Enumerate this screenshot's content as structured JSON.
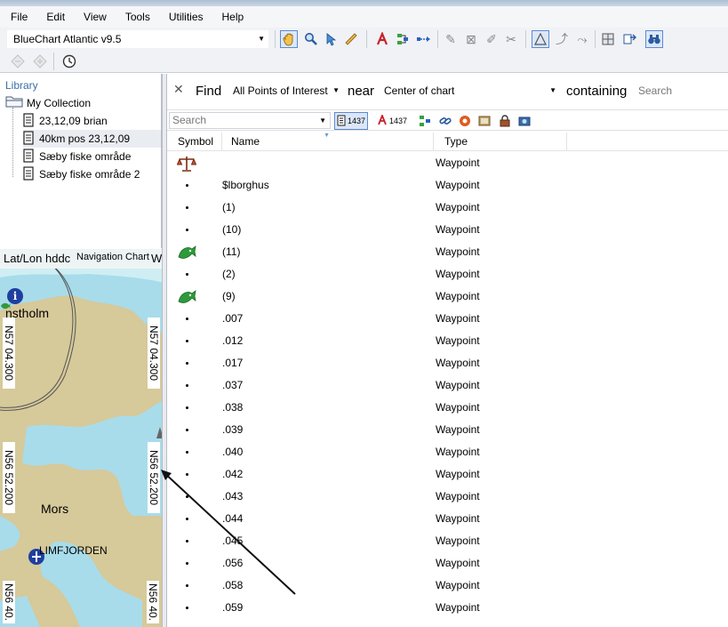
{
  "menu": [
    "File",
    "Edit",
    "View",
    "Tools",
    "Utilities",
    "Help"
  ],
  "toolbar": {
    "chart_select": "BlueChart Atlantic v9.5",
    "icons": [
      "hand-pan-icon",
      "zoom-icon",
      "pointer-icon",
      "measure-ruler-icon",
      "route-tool-icon",
      "track-tool-icon",
      "route-join-icon",
      "pencil-icon",
      "eraser-icon",
      "erase-all-icon",
      "cut-icon",
      "select-icon",
      "waypoint-tool-icon",
      "route-edit-icon",
      "grid-icon",
      "transfer-icon",
      "binoculars-icon"
    ]
  },
  "library": {
    "title": "Library",
    "collection": "My Collection",
    "items": [
      {
        "label": "23,12,09 brian"
      },
      {
        "label": "40km pos 23,12,09"
      },
      {
        "label": "Sæby fiske område"
      },
      {
        "label": "Sæby fiske område 2"
      }
    ]
  },
  "map": {
    "header_left": "Lat/Lon hddc",
    "header_tab": "Navigation Chart",
    "header_right": "W",
    "labels": {
      "place1": "nstholm",
      "place2": "Mors",
      "place3": "LIMFJORDEN",
      "lat1": "N57 04.300",
      "lat1r": "N57 04.300",
      "lat2": "N56 52.200",
      "lat2r": "N56 52.200",
      "lat3": "N56 40.",
      "lat3r": "N56 40."
    }
  },
  "find": {
    "find_label": "Find",
    "what": "All Points of Interest",
    "near_label": "near",
    "near": "Center of chart",
    "containing_label": "containing",
    "search_placeholder": "Search"
  },
  "filter": {
    "search_placeholder": "Search",
    "waypoint_count": "1437",
    "route_count": "1437"
  },
  "columns": [
    "Symbol",
    "Name",
    "Type"
  ],
  "rows": [
    {
      "symbol": "scales-icon",
      "name": "",
      "type": "Waypoint"
    },
    {
      "symbol": "dot",
      "name": "$lborghus",
      "type": "Waypoint"
    },
    {
      "symbol": "dot",
      "name": "(1)",
      "type": "Waypoint"
    },
    {
      "symbol": "dot",
      "name": "(10)",
      "type": "Waypoint"
    },
    {
      "symbol": "fish-icon",
      "name": "(11)",
      "type": "Waypoint"
    },
    {
      "symbol": "dot",
      "name": "(2)",
      "type": "Waypoint"
    },
    {
      "symbol": "fish-icon",
      "name": "(9)",
      "type": "Waypoint"
    },
    {
      "symbol": "dot",
      "name": ".007",
      "type": "Waypoint"
    },
    {
      "symbol": "dot",
      "name": ".012",
      "type": "Waypoint"
    },
    {
      "symbol": "dot",
      "name": ".017",
      "type": "Waypoint"
    },
    {
      "symbol": "dot",
      "name": ".037",
      "type": "Waypoint"
    },
    {
      "symbol": "dot",
      "name": ".038",
      "type": "Waypoint"
    },
    {
      "symbol": "dot",
      "name": ".039",
      "type": "Waypoint"
    },
    {
      "symbol": "dot",
      "name": ".040",
      "type": "Waypoint"
    },
    {
      "symbol": "dot",
      "name": ".042",
      "type": "Waypoint"
    },
    {
      "symbol": "dot",
      "name": ".043",
      "type": "Waypoint"
    },
    {
      "symbol": "dot",
      "name": ".044",
      "type": "Waypoint"
    },
    {
      "symbol": "dot",
      "name": ".045",
      "type": "Waypoint"
    },
    {
      "symbol": "dot",
      "name": ".056",
      "type": "Waypoint"
    },
    {
      "symbol": "dot",
      "name": ".058",
      "type": "Waypoint"
    },
    {
      "symbol": "dot",
      "name": ".059",
      "type": "Waypoint"
    }
  ],
  "colors": {
    "water": "#a8dcea",
    "land": "#d6c99a",
    "accent": "#3a6ea8",
    "fish": "#2e9a3a"
  }
}
